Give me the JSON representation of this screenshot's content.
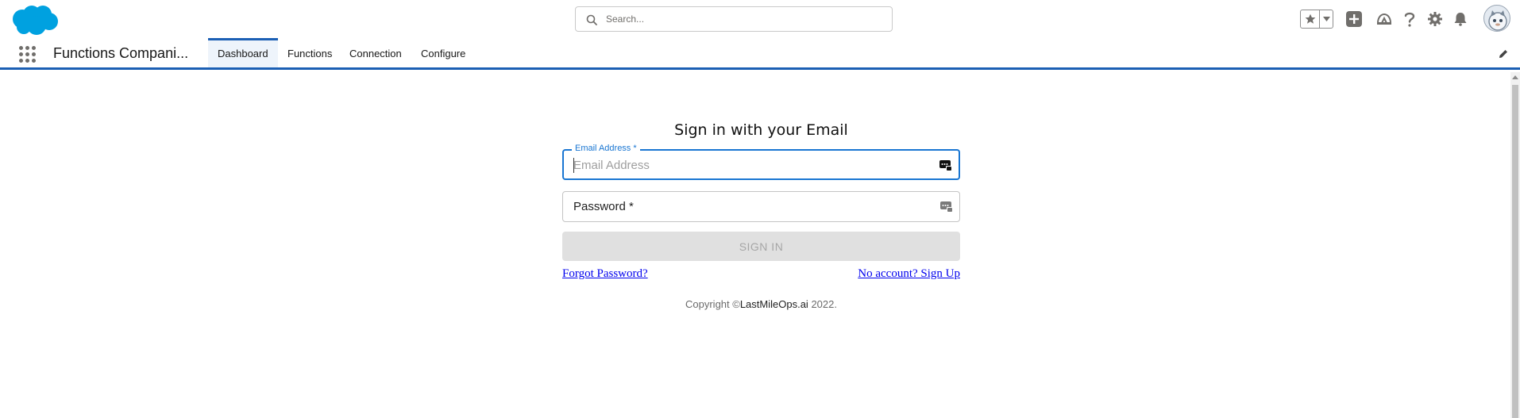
{
  "header": {
    "logo": "salesforce-cloud-logo",
    "search_placeholder": "Search...",
    "icons": [
      "star-icon",
      "chevron-down-icon",
      "add-icon",
      "trailhead-icon",
      "help-icon",
      "gear-icon",
      "bell-icon"
    ],
    "avatar": "user-avatar"
  },
  "nav": {
    "app_name": "Functions Compani...",
    "tabs": [
      {
        "label": "Dashboard",
        "active": true
      },
      {
        "label": "Functions",
        "active": false
      },
      {
        "label": "Connection",
        "active": false
      },
      {
        "label": "Configure",
        "active": false
      }
    ]
  },
  "signin": {
    "title": "Sign in with your Email",
    "email_label": "Email Address *",
    "email_placeholder": "Email Address",
    "email_value": "",
    "password_label": "Password *",
    "password_value": "",
    "button_label": "SIGN IN",
    "forgot_link": "Forgot Password?",
    "signup_link": "No account? Sign Up",
    "copyright_prefix": "Copyright ©",
    "copyright_brand": "LastMileOps.ai",
    "copyright_year": "2022."
  },
  "colors": {
    "accent": "#1976d2",
    "nav_border": "#1b5fb4",
    "logo": "#00a1e0",
    "disabled_button": "#e0e0e0",
    "link": "#0000ee"
  }
}
